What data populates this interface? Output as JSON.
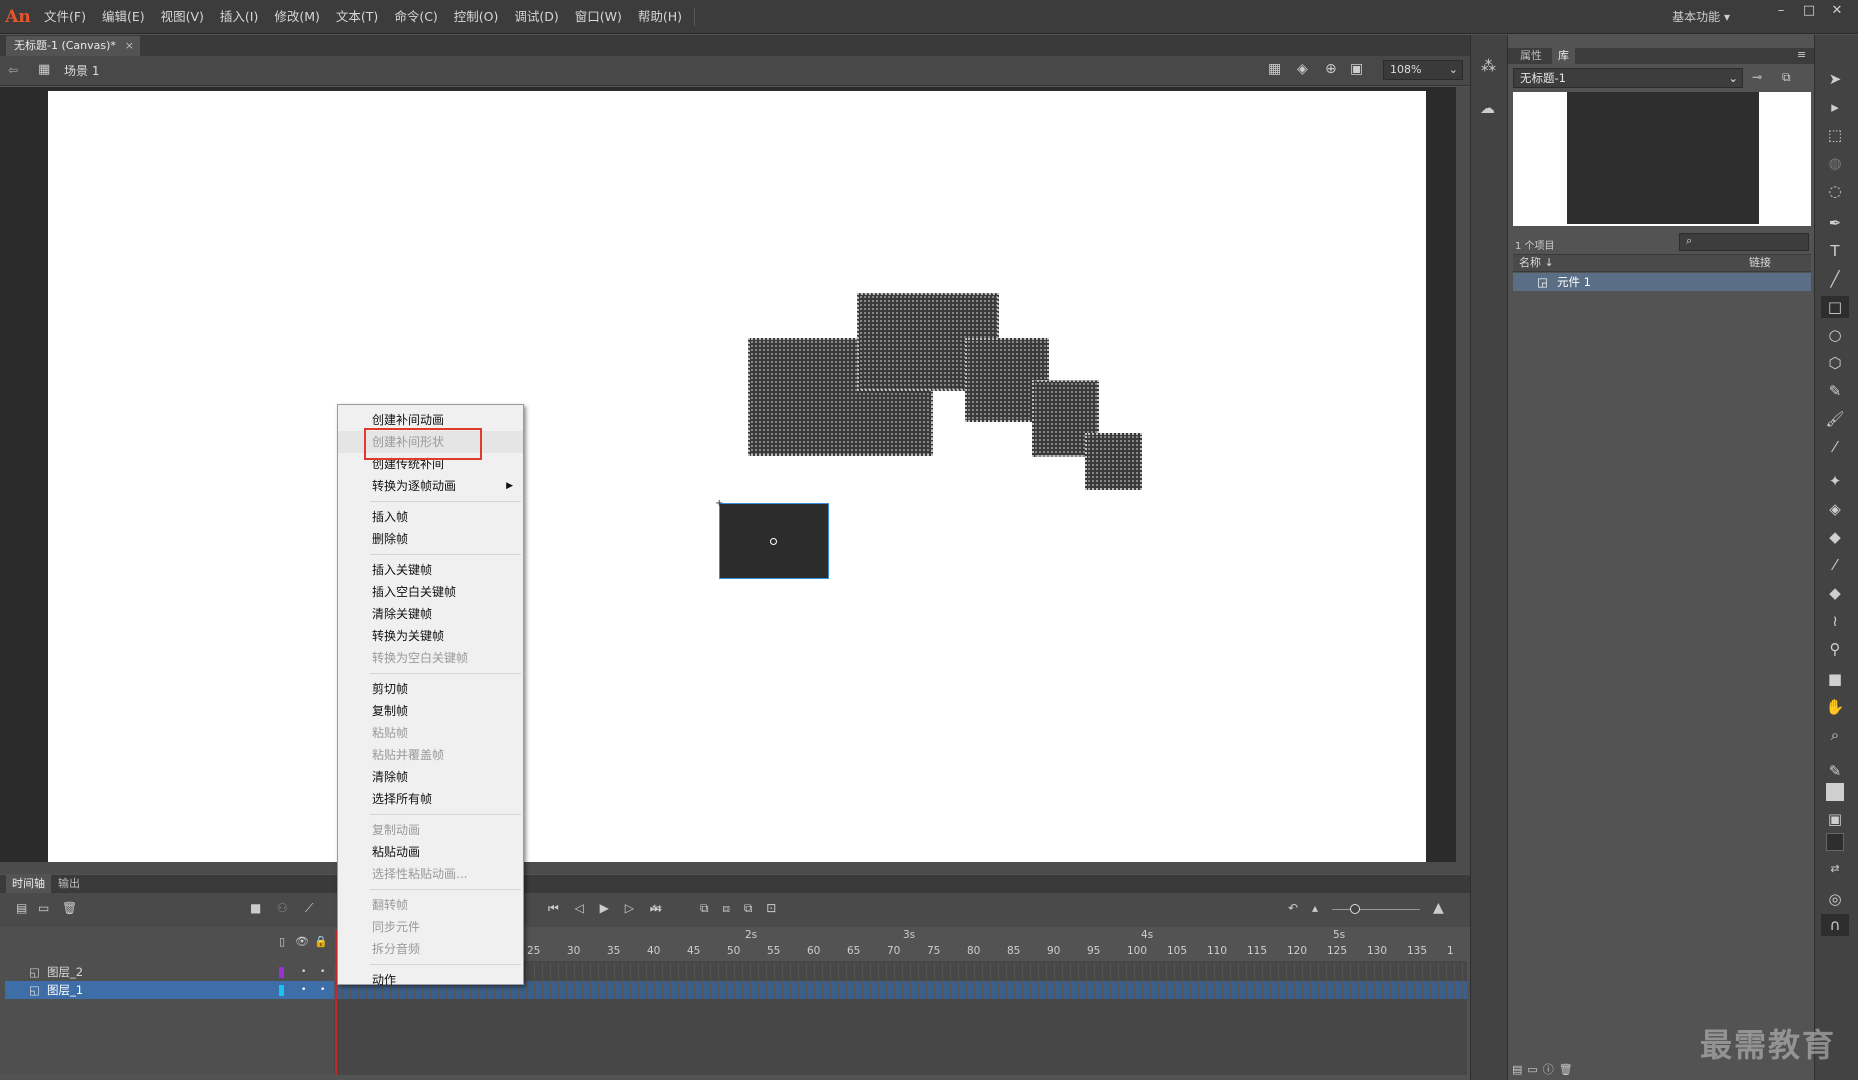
{
  "app": {
    "logo": "An",
    "menu": [
      "文件(F)",
      "编辑(E)",
      "视图(V)",
      "插入(I)",
      "修改(M)",
      "文本(T)",
      "命令(C)",
      "控制(O)",
      "调试(D)",
      "窗口(W)",
      "帮助(H)"
    ],
    "workspace": "基本功能",
    "win_minimize": "–",
    "win_maximize": "□",
    "win_close": "✕"
  },
  "document": {
    "tab_title": "无标题-1 (Canvas)*",
    "tab_close": "×",
    "scene": "场景 1",
    "zoom": "108%"
  },
  "context_menu": {
    "items": [
      {
        "label": "创建补间动画",
        "disabled": false
      },
      {
        "label": "创建补间形状",
        "disabled": true
      },
      {
        "label": "创建传统补间",
        "disabled": false
      },
      {
        "label": "转换为逐帧动画",
        "disabled": false,
        "submenu": true
      },
      {
        "label": "插入帧",
        "disabled": false
      },
      {
        "label": "删除帧",
        "disabled": false
      },
      {
        "label": "插入关键帧",
        "disabled": false
      },
      {
        "label": "插入空白关键帧",
        "disabled": false
      },
      {
        "label": "清除关键帧",
        "disabled": false
      },
      {
        "label": "转换为关键帧",
        "disabled": false
      },
      {
        "label": "转换为空白关键帧",
        "disabled": true
      },
      {
        "label": "剪切帧",
        "disabled": false
      },
      {
        "label": "复制帧",
        "disabled": false
      },
      {
        "label": "粘贴帧",
        "disabled": true
      },
      {
        "label": "粘贴并覆盖帧",
        "disabled": true
      },
      {
        "label": "清除帧",
        "disabled": false
      },
      {
        "label": "选择所有帧",
        "disabled": false
      },
      {
        "label": "复制动画",
        "disabled": true
      },
      {
        "label": "粘贴动画",
        "disabled": false
      },
      {
        "label": "选择性粘贴动画...",
        "disabled": true
      },
      {
        "label": "翻转帧",
        "disabled": true
      },
      {
        "label": "同步元件",
        "disabled": true
      },
      {
        "label": "拆分音频",
        "disabled": true
      },
      {
        "label": "动作",
        "disabled": false
      }
    ]
  },
  "timeline": {
    "tab_timeline": "时间轴",
    "tab_output": "输出",
    "layers": [
      {
        "name": "图层_2",
        "color": "#9b2fd6",
        "selected": false
      },
      {
        "name": "图层_1",
        "color": "#19c3f0",
        "selected": true
      }
    ],
    "seconds": [
      "2s",
      "3s",
      "4s",
      "5s"
    ],
    "frame_numbers": [
      "25",
      "30",
      "35",
      "40",
      "45",
      "50",
      "55",
      "60",
      "65",
      "70",
      "75",
      "80",
      "85",
      "90",
      "95",
      "100",
      "105",
      "110",
      "115",
      "120",
      "125",
      "130",
      "135",
      "1"
    ]
  },
  "library": {
    "tab_properties": "属性",
    "tab_library": "库",
    "document_select": "无标题-1",
    "item_count": "1 个项目",
    "col_name": "名称 ↓",
    "col_linkage": "链接",
    "items": [
      {
        "name": "元件 1"
      }
    ]
  },
  "watermark": "最需教育"
}
